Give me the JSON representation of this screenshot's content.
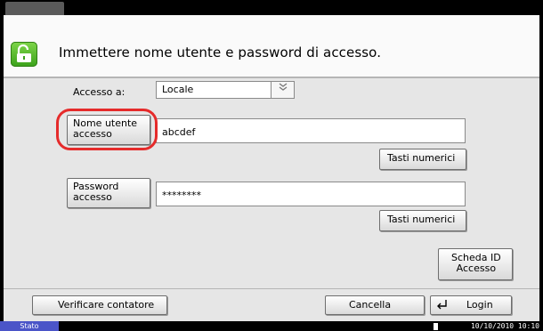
{
  "prompt": "Immettere nome utente e password di accesso.",
  "access": {
    "label": "Accesso a:",
    "value": "Locale"
  },
  "username": {
    "button_line1": "Nome utente",
    "button_line2": "accesso",
    "value": "abcdef",
    "keys_label": "Tasti numerici"
  },
  "password": {
    "button_line1": "Password",
    "button_line2": "accesso",
    "value": "********",
    "keys_label": "Tasti numerici"
  },
  "id_card": {
    "line1": "Scheda ID",
    "line2": "Accesso"
  },
  "footer": {
    "counter_label": "Verificare contatore",
    "cancel_label": "Cancella",
    "login_label": "Login"
  },
  "status": {
    "label": "Stato",
    "datetime": "10/10/2010 10:10"
  },
  "colors": {
    "lock_icon": "#5cbf2a",
    "highlight_ring": "#e52b2b",
    "status_tab": "#4b55c8"
  },
  "icons": {
    "lock": "unlocked-padlock-icon",
    "enter": "enter-arrow-icon",
    "dropdown": "double-chevron-down-icon"
  }
}
